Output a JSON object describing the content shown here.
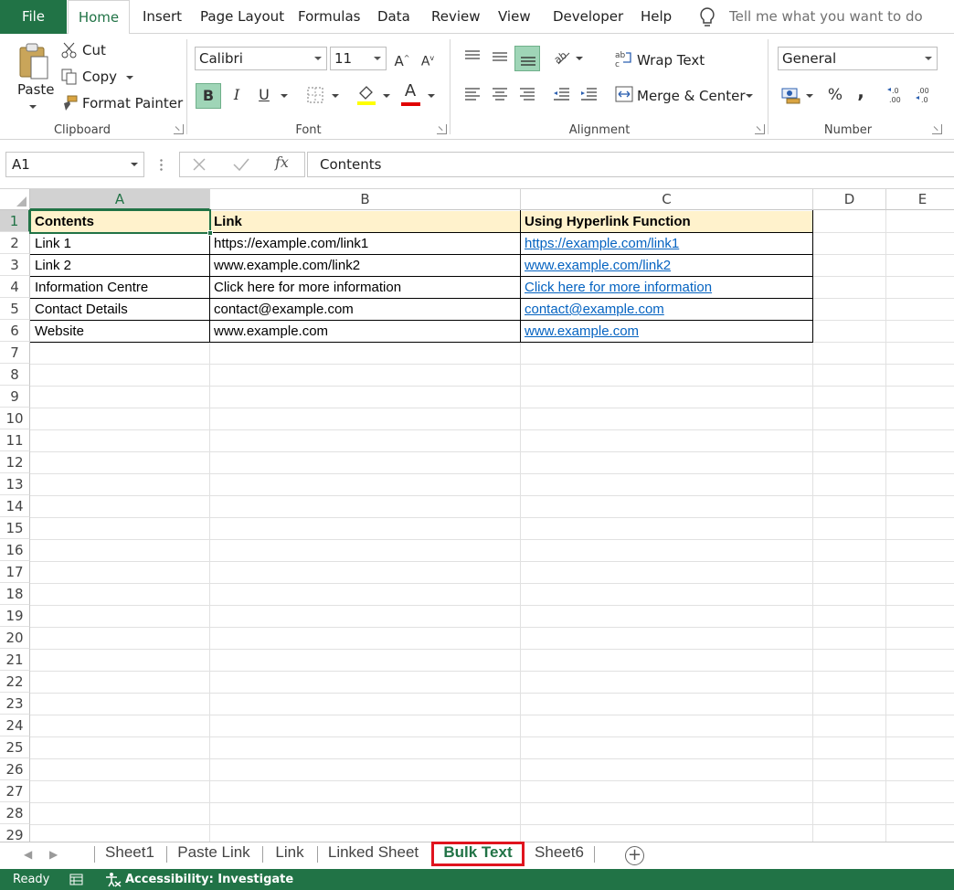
{
  "ribbon_tabs": [
    {
      "label": "File"
    },
    {
      "label": "Home"
    },
    {
      "label": "Insert"
    },
    {
      "label": "Page Layout"
    },
    {
      "label": "Formulas"
    },
    {
      "label": "Data"
    },
    {
      "label": "Review"
    },
    {
      "label": "View"
    },
    {
      "label": "Developer"
    },
    {
      "label": "Help"
    }
  ],
  "tell_me": "Tell me what you want to do",
  "clipboard": {
    "paste": "Paste",
    "cut": "Cut",
    "copy": "Copy",
    "format_painter": "Format Painter",
    "group": "Clipboard"
  },
  "font": {
    "family": "Calibri",
    "size": "11",
    "group": "Font",
    "bold": "B",
    "italic": "I",
    "underline": "U",
    "grow": "A",
    "shrink": "A",
    "color_letter": "A",
    "highlight_color": "#ffff00",
    "font_color": "#e00000"
  },
  "alignment": {
    "wrap_text": "Wrap Text",
    "merge_center": "Merge & Center",
    "group": "Alignment"
  },
  "number": {
    "format": "General",
    "group": "Number",
    "percent": "%",
    "comma": ",",
    "inc_decimal": "←.0\n.00",
    "dec_decimal": ".00\n→.0"
  },
  "formula_bar": {
    "name_box": "A1",
    "fx": "fx",
    "content": "Contents"
  },
  "columns": [
    "A",
    "B",
    "C",
    "D",
    "E"
  ],
  "rows": [
    "1",
    "2",
    "3",
    "4",
    "5",
    "6",
    "7",
    "8",
    "9",
    "10",
    "11",
    "12",
    "13",
    "14",
    "15",
    "16",
    "17",
    "18",
    "19",
    "20",
    "21",
    "22",
    "23",
    "24",
    "25",
    "26",
    "27",
    "28",
    "29"
  ],
  "table": {
    "headers": [
      "Contents",
      "Link",
      "Using Hyperlink Function"
    ],
    "rows": [
      [
        "Link 1",
        "https://example.com/link1",
        "https://example.com/link1"
      ],
      [
        "Link 2",
        "www.example.com/link2",
        "www.example.com/link2"
      ],
      [
        "Information Centre",
        "Click here for more information",
        "Click here for more information"
      ],
      [
        "Contact Details",
        "contact@example.com",
        "contact@example.com"
      ],
      [
        "Website",
        "www.example.com",
        "www.example.com"
      ]
    ]
  },
  "sheets": [
    {
      "label": "Sheet1"
    },
    {
      "label": "Paste Link"
    },
    {
      "label": "Link"
    },
    {
      "label": "Linked Sheet"
    },
    {
      "label": "Bulk Text"
    },
    {
      "label": "Sheet6"
    }
  ],
  "active_sheet": "Bulk Text",
  "status": {
    "ready": "Ready",
    "accessibility": "Accessibility: Investigate"
  },
  "colors": {
    "accent": "#217346",
    "link": "#0563c1",
    "header_fill": "#fff2cc",
    "tab_highlight": "#e0141e"
  }
}
